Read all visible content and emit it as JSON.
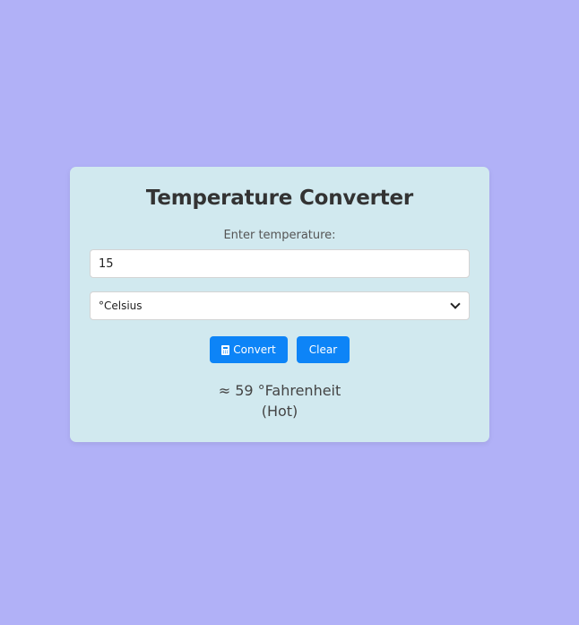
{
  "converter": {
    "title": "Temperature Converter",
    "input_label": "Enter temperature:",
    "input_value": "15",
    "unit_selected": "°Celsius",
    "convert_label": "Convert",
    "clear_label": "Clear",
    "result_value": "≈ 59 °Fahrenheit",
    "result_note": "(Hot)"
  },
  "icons": {
    "convert_icon": "calculator-icon",
    "select_icon": "chevron-down-icon"
  },
  "colors": {
    "background": "#b1b1f7",
    "card": "#d1e9ef",
    "button": "#0d84f7",
    "title_text": "#333333"
  }
}
